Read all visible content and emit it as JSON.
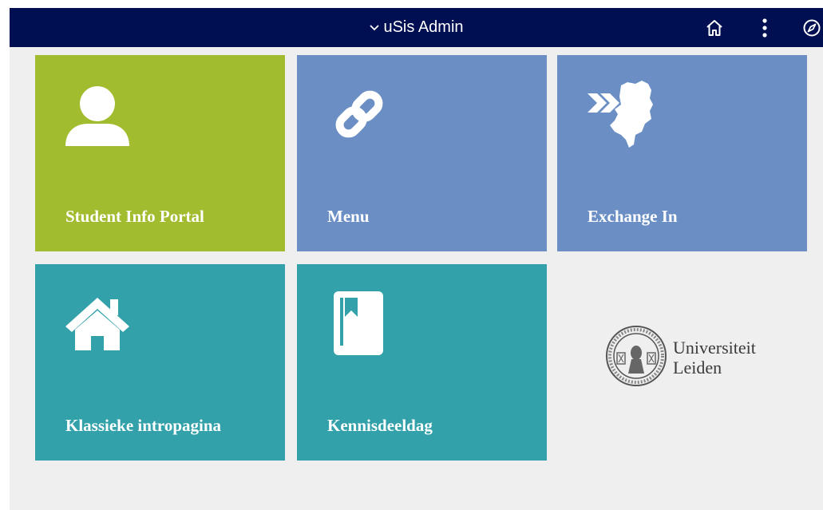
{
  "header": {
    "title": "uSis Admin",
    "icons": [
      "chevron-down-icon",
      "home-icon",
      "more-vertical-icon",
      "compass-icon"
    ]
  },
  "tiles": [
    {
      "label": "Student Info Portal",
      "icon": "user-icon",
      "color": "#a2bc2f"
    },
    {
      "label": "Menu",
      "icon": "link-icon",
      "color": "#6b8fc4"
    },
    {
      "label": "Exchange In",
      "icon": "exchange-netherlands-icon",
      "color": "#6b8fc4"
    },
    {
      "label": "Klassieke intropagina",
      "icon": "house-icon",
      "color": "#33a1aa"
    },
    {
      "label": "Kennisdeeldag",
      "icon": "book-icon",
      "color": "#33a1aa"
    }
  ],
  "logo": {
    "line1": "Universiteit",
    "line2": "Leiden",
    "icon": "university-seal-icon"
  },
  "colors": {
    "header_bg": "#000e52",
    "page_bg": "#efefef"
  }
}
